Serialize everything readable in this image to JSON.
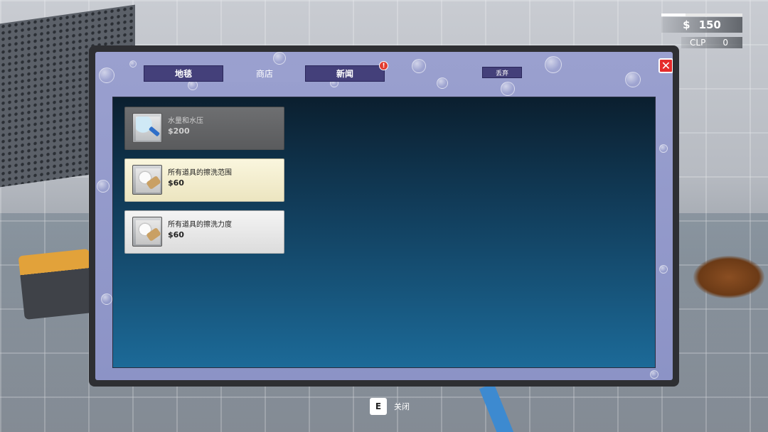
{
  "hud": {
    "currency_symbol": "$",
    "money": "150",
    "clp_label": "CLP",
    "clp_value": "0",
    "progress": 0.3
  },
  "tabs": [
    {
      "label": "地毯",
      "active": false
    },
    {
      "label": "商店",
      "active": true
    },
    {
      "label": "新闻",
      "active": false,
      "badge": "!"
    }
  ],
  "toolbar": {
    "discard_label": "丢弃",
    "close_glyph": "✕"
  },
  "shop": {
    "items": [
      {
        "name": "水量和水压",
        "price": "$200",
        "state": "locked",
        "icon": "nozzle-icon"
      },
      {
        "name": "所有道具的擦洗范围",
        "price": "$60",
        "state": "selected",
        "icon": "sponge-range-icon"
      },
      {
        "name": "所有道具的擦洗力度",
        "price": "$60",
        "state": "normal",
        "icon": "sponge-power-icon"
      }
    ]
  },
  "hint": {
    "key": "E",
    "label": "关闭"
  },
  "colors": {
    "tab_bg": "#44407a",
    "panel_bg": "#9aa0cf",
    "close_red": "#e52b2b",
    "badge_red": "#e23b2f"
  }
}
